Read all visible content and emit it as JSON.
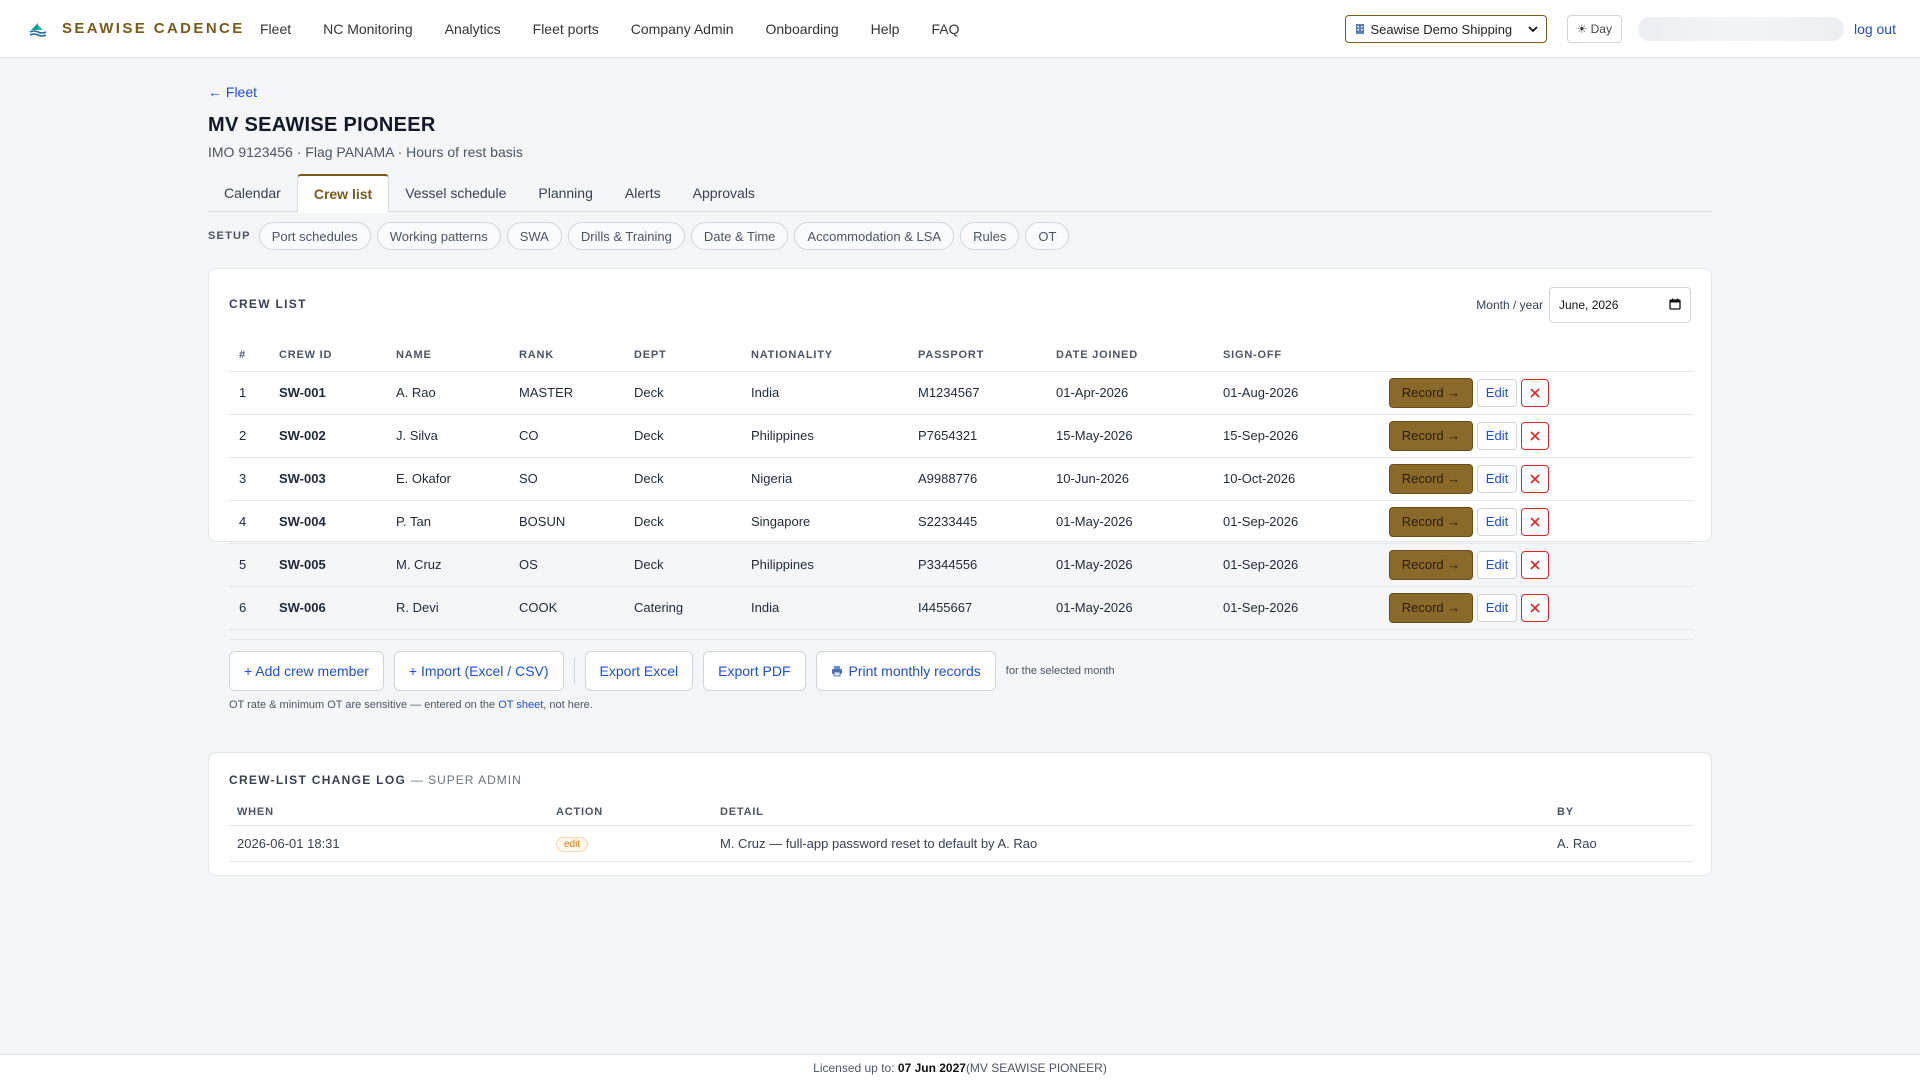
{
  "brand": {
    "name": "SEAWISE CADENCE",
    "logo_icon": "ship-wave-icon"
  },
  "nav": [
    "Fleet",
    "NC Monitoring",
    "Analytics",
    "Fleet ports",
    "Company Admin",
    "Onboarding",
    "Help",
    "FAQ"
  ],
  "header": {
    "company_select": "Seawise Demo Shipping",
    "theme_toggle": "☀ Day",
    "logout": "log out"
  },
  "page": {
    "back_link": "← Fleet",
    "vessel_name": "MV SEAWISE PIONEER",
    "vessel_meta": "IMO 9123456 · Flag PANAMA · Hours of rest basis"
  },
  "tabs": [
    "Calendar",
    "Crew list",
    "Vessel schedule",
    "Planning",
    "Alerts",
    "Approvals"
  ],
  "active_tab": "Crew list",
  "setup": {
    "label": "SETUP",
    "items": [
      "Port schedules",
      "Working patterns",
      "SWA",
      "Drills & Training",
      "Date & Time",
      "Accommodation & LSA",
      "Rules",
      "OT"
    ]
  },
  "crew_list": {
    "title": "CREW LIST",
    "month_label": "Month / year",
    "month_value": "June, 2026",
    "columns": [
      "#",
      "CREW ID",
      "NAME",
      "RANK",
      "DEPT",
      "NATIONALITY",
      "PASSPORT",
      "DATE JOINED",
      "SIGN-OFF"
    ],
    "rows": [
      {
        "n": "1",
        "id": "SW-001",
        "name": "A. Rao",
        "rank": "MASTER",
        "dept": "Deck",
        "nationality": "India",
        "passport": "M1234567",
        "joined": "01-Apr-2026",
        "signoff": "01-Aug-2026"
      },
      {
        "n": "2",
        "id": "SW-002",
        "name": "J. Silva",
        "rank": "CO",
        "dept": "Deck",
        "nationality": "Philippines",
        "passport": "P7654321",
        "joined": "15-May-2026",
        "signoff": "15-Sep-2026"
      },
      {
        "n": "3",
        "id": "SW-003",
        "name": "E. Okafor",
        "rank": "SO",
        "dept": "Deck",
        "nationality": "Nigeria",
        "passport": "A9988776",
        "joined": "10-Jun-2026",
        "signoff": "10-Oct-2026"
      },
      {
        "n": "4",
        "id": "SW-004",
        "name": "P. Tan",
        "rank": "BOSUN",
        "dept": "Deck",
        "nationality": "Singapore",
        "passport": "S2233445",
        "joined": "01-May-2026",
        "signoff": "01-Sep-2026"
      },
      {
        "n": "5",
        "id": "SW-005",
        "name": "M. Cruz",
        "rank": "OS",
        "dept": "Deck",
        "nationality": "Philippines",
        "passport": "P3344556",
        "joined": "01-May-2026",
        "signoff": "01-Sep-2026"
      },
      {
        "n": "6",
        "id": "SW-006",
        "name": "R. Devi",
        "rank": "COOK",
        "dept": "Catering",
        "nationality": "India",
        "passport": "I4455667",
        "joined": "01-May-2026",
        "signoff": "01-Sep-2026"
      }
    ],
    "record_label": "Record →",
    "edit_label": "Edit",
    "buttons": {
      "add": "+ Add crew member",
      "import": "+ Import (Excel / CSV)",
      "export_excel": "Export Excel",
      "export_pdf": "Export PDF",
      "print": "Print monthly records"
    },
    "print_hint": "for the selected month",
    "note_prefix": "OT rate & minimum OT are sensitive — entered on the ",
    "note_link": "OT sheet",
    "note_suffix": ", not here."
  },
  "change_log": {
    "title": "CREW-LIST CHANGE LOG",
    "subtitle": "— SUPER ADMIN",
    "columns": [
      "WHEN",
      "ACTION",
      "DETAIL",
      "BY"
    ],
    "rows": [
      {
        "when": "2026-06-01 18:31",
        "action": "edit",
        "detail": "M. Cruz — full-app password reset to default by A. Rao",
        "by": "A. Rao"
      }
    ]
  },
  "footer": {
    "prefix": "Licensed up to: ",
    "date": "07 Jun 2027",
    "suffix": " (MV SEAWISE PIONEER)"
  },
  "colors": {
    "accent": "#7a5a1a",
    "record_bg": "#8a6a2a",
    "link": "#1d4ed8",
    "danger": "#dc2626"
  }
}
